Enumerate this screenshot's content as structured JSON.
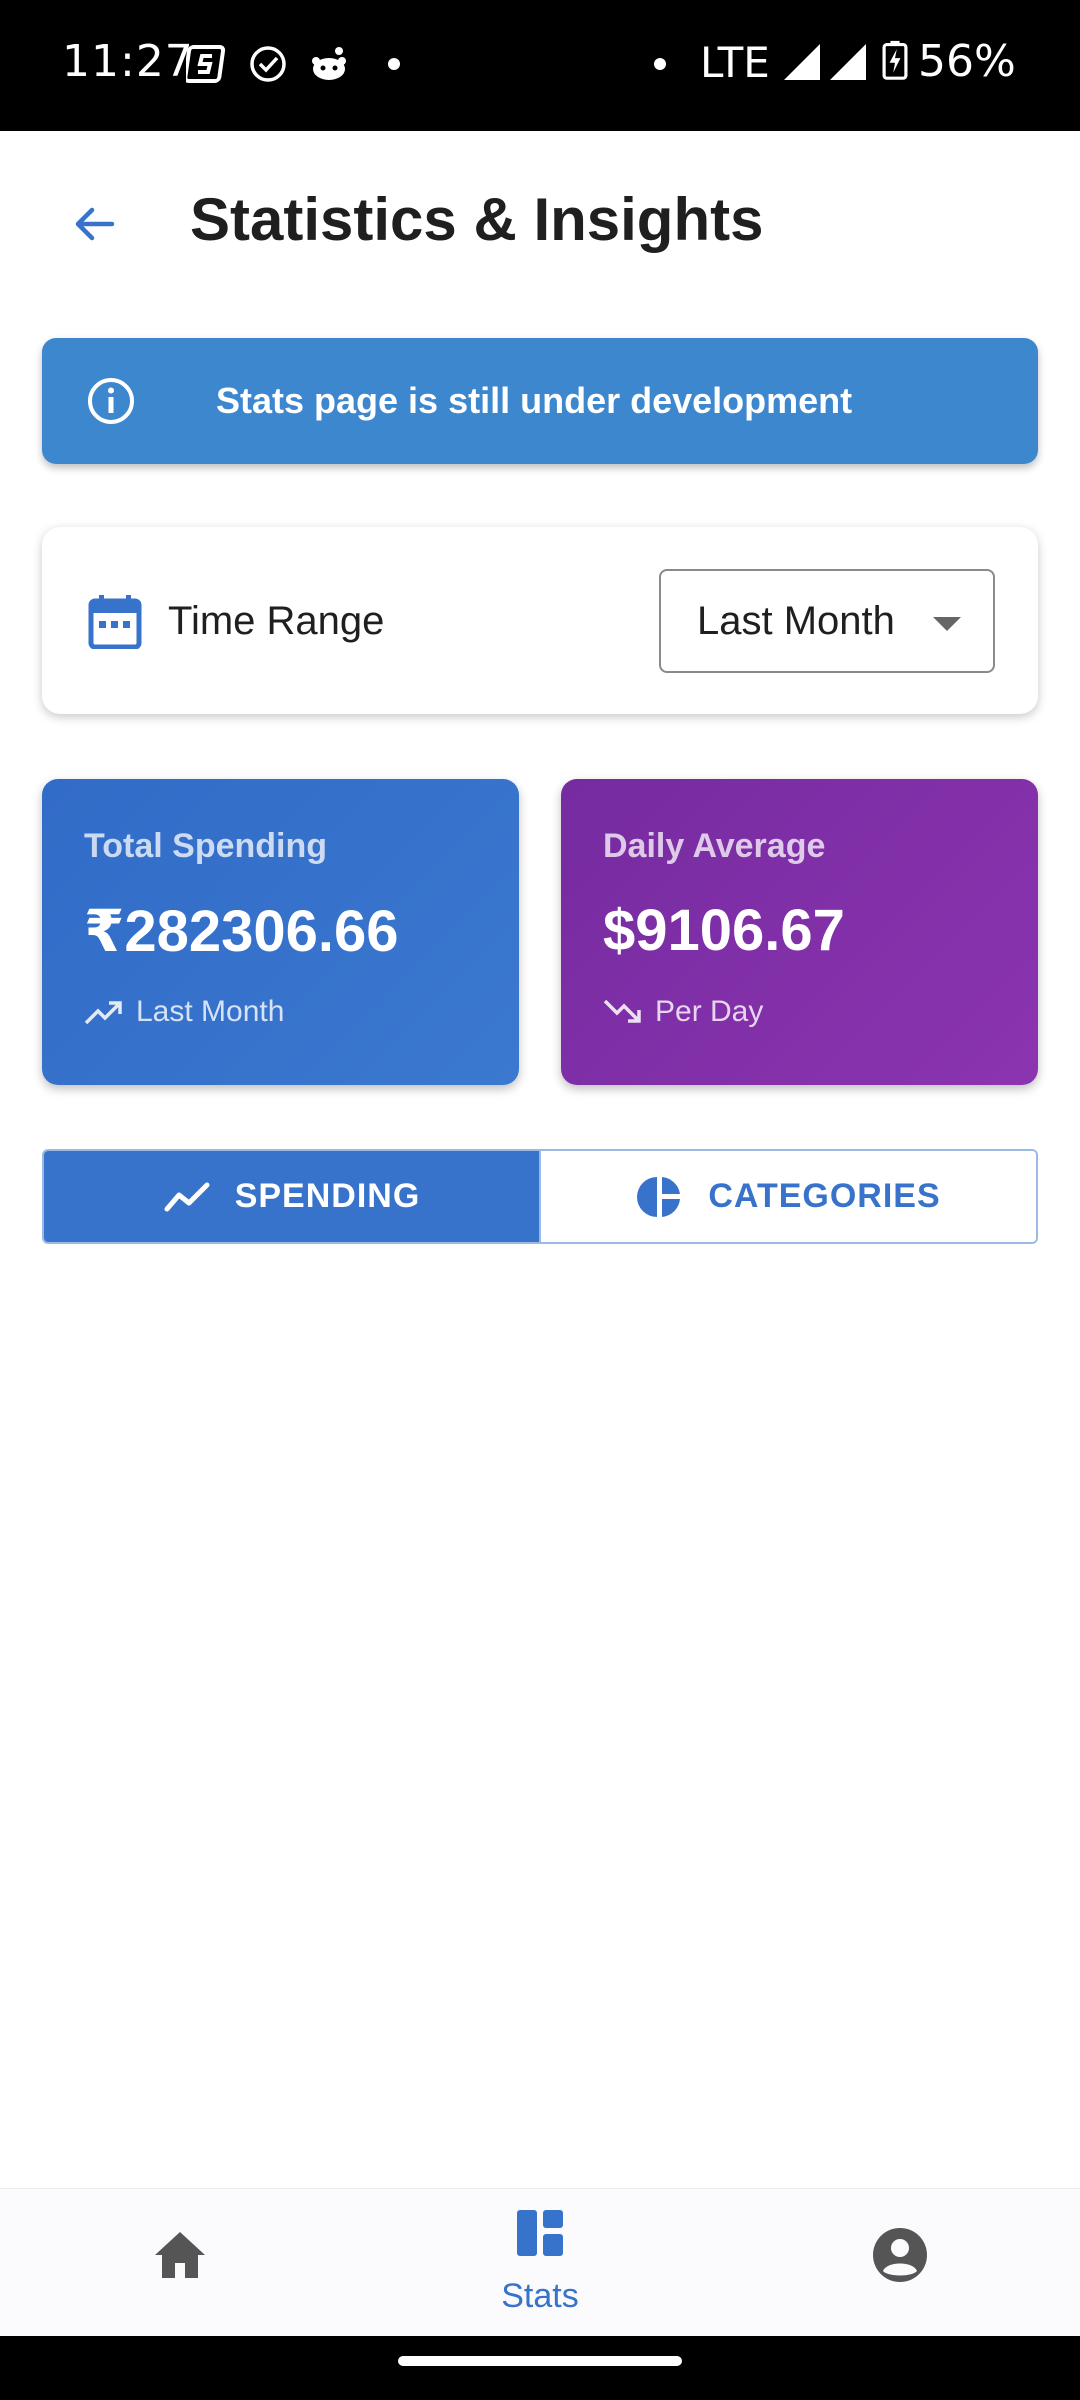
{
  "status_bar": {
    "time": "11:27",
    "network": "LTE",
    "battery": "56%"
  },
  "header": {
    "title": "Statistics & Insights",
    "back_icon": "arrow-back-icon"
  },
  "banner": {
    "text": "Stats page is still under development",
    "icon": "info-icon"
  },
  "time_range": {
    "label": "Time Range",
    "selected": "Last Month",
    "icon": "calendar-icon"
  },
  "cards": {
    "total": {
      "label": "Total Spending",
      "value": "₹282306.66",
      "sub": "Last Month",
      "icon": "trending-up-icon",
      "color": "#3570c9"
    },
    "daily": {
      "label": "Daily Average",
      "value": "$9106.67",
      "sub": "Per Day",
      "icon": "trending-down-icon",
      "color": "#8231a8"
    }
  },
  "tabs": [
    {
      "label": "SPENDING",
      "icon": "line-chart-icon",
      "active": true
    },
    {
      "label": "CATEGORIES",
      "icon": "pie-chart-icon",
      "active": false
    }
  ],
  "bottom_nav": [
    {
      "label": "",
      "icon": "home-icon"
    },
    {
      "label": "Stats",
      "icon": "dashboard-icon",
      "active": true
    },
    {
      "label": "",
      "icon": "account-icon"
    }
  ],
  "colors": {
    "primary": "#3773ca",
    "banner": "#3d87cf"
  }
}
